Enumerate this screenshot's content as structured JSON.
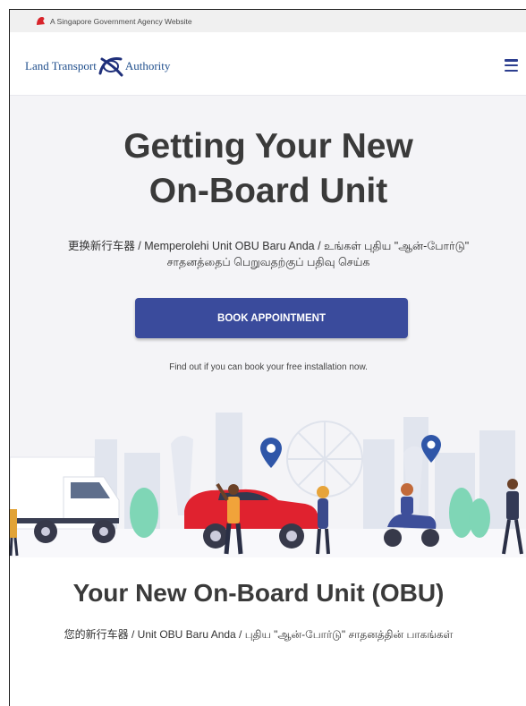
{
  "masthead": {
    "text": "A Singapore Government Agency Website"
  },
  "header": {
    "logo_left": "Land Transport",
    "logo_right": "Authority",
    "menu_icon": "hamburger-menu-icon"
  },
  "hero": {
    "title_line1": "Getting Your New",
    "title_line2": "On-Board Unit",
    "subtitle": "更换新行车器 / Memperolehi Unit OBU Baru Anda / உங்கள் புதிய \"ஆன்-போர்டு\" சாதனத்தைப் பெறுவதற்குப் பதிவு செய்க",
    "button_label": "BOOK APPOINTMENT",
    "note": "Find out if you can book your free installation now."
  },
  "section": {
    "title": "Your New On-Board Unit (OBU)",
    "subtitle": "您的新行车器 / Unit OBU Baru Anda / புதிய \"ஆன்-போர்டு\" சாதனத்தின் பாகங்கள்"
  },
  "colors": {
    "brand_blue": "#3a4b9c",
    "car_red": "#e0222f",
    "pin_blue": "#2f56a8"
  }
}
